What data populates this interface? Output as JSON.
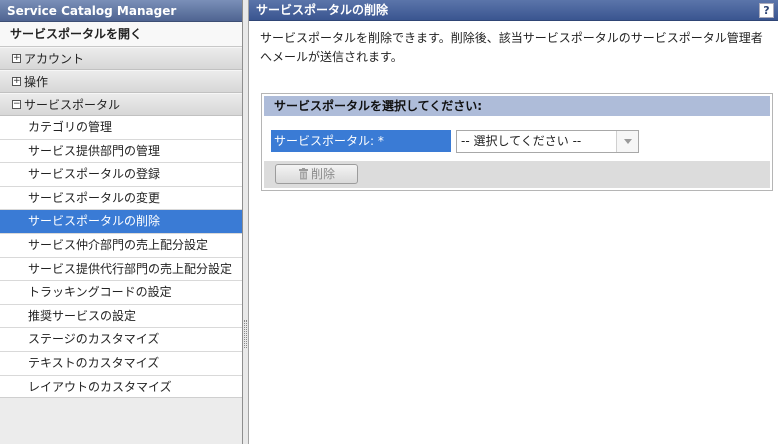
{
  "sidebar": {
    "app_title": "Service Catalog Manager",
    "open_portal": "サービスポータルを開く",
    "groups": [
      {
        "toggle": "+",
        "label": "アカウント"
      },
      {
        "toggle": "+",
        "label": "操作"
      },
      {
        "toggle": "−",
        "label": "サービスポータル"
      }
    ],
    "items": [
      {
        "label": "カテゴリの管理"
      },
      {
        "label": "サービス提供部門の管理"
      },
      {
        "label": "サービスポータルの登録"
      },
      {
        "label": "サービスポータルの変更"
      },
      {
        "label": "サービスポータルの削除",
        "active": true
      },
      {
        "label": "サービス仲介部門の売上配分設定"
      },
      {
        "label": "サービス提供代行部門の売上配分設定"
      },
      {
        "label": "トラッキングコードの設定"
      },
      {
        "label": "推奨サービスの設定"
      },
      {
        "label": "ステージのカスタマイズ"
      },
      {
        "label": "テキストのカスタマイズ"
      },
      {
        "label": "レイアウトのカスタマイズ"
      }
    ]
  },
  "main": {
    "title": "サービスポータルの削除",
    "help_label": "?",
    "description": "サービスポータルを削除できます。削除後、該当サービスポータルのサービスポータル管理者へメールが送信されます。",
    "panel": {
      "heading": "サービスポータルを選択してください:",
      "field_label": "サービスポータル: *",
      "select_value": "-- 選択してください --",
      "delete_label": "削除"
    }
  },
  "colors": {
    "active_item": "#3a7bd5",
    "title_bar": "#3a5590",
    "panel_heading": "#aebcd9"
  }
}
